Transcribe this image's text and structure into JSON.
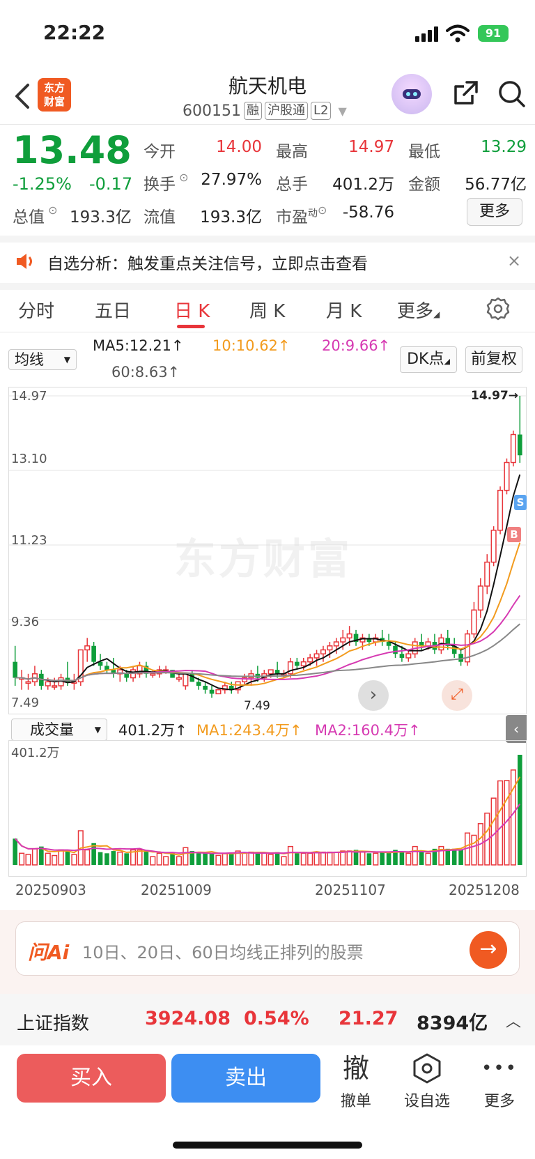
{
  "status": {
    "time": "22:22",
    "battery": "91"
  },
  "header": {
    "logo_text": "东方财富",
    "stock_name": "航天机电",
    "code": "600151",
    "tags": [
      "融",
      "沪股通",
      "L2"
    ]
  },
  "quote": {
    "price": "13.48",
    "change_pct": "-1.25%",
    "change_abs": "-0.17",
    "fields": [
      {
        "label": "今开",
        "value": "14.00",
        "color": "red"
      },
      {
        "label": "最高",
        "value": "14.97",
        "color": "red"
      },
      {
        "label": "最低",
        "value": "13.29",
        "color": "green"
      },
      {
        "label": "换手",
        "value": "27.97%",
        "color": "black"
      },
      {
        "label": "总手",
        "value": "401.2万",
        "color": "black"
      },
      {
        "label": "金额",
        "value": "56.77亿",
        "color": "black"
      },
      {
        "label": "流值",
        "value": "193.3亿",
        "color": "black"
      },
      {
        "label": "市盈",
        "value": "-58.76",
        "color": "black"
      }
    ],
    "total_value_label": "总值",
    "total_value": "193.3亿",
    "pe_super": "动",
    "more_label": "更多"
  },
  "notice": {
    "text": "自选分析：触发重点关注信号，立即点击查看",
    "close": "×"
  },
  "tabs": [
    "分时",
    "五日",
    "日 K",
    "周 K",
    "月 K",
    "更多"
  ],
  "ma_row": {
    "select": "均线",
    "ma5": "MA5:12.21↑",
    "ma10": "10:10.62↑",
    "ma20": "20:9.66↑",
    "ma60": "60:8.63↑",
    "dk": "DK点",
    "fq": "前复权"
  },
  "chart": {
    "price_ticks": [
      "14.97",
      "13.10",
      "11.23",
      "9.36",
      "7.49"
    ],
    "high_label": "14.97→",
    "low_label": "7.49",
    "watermark": "东方财富",
    "s_mark": "S",
    "b_mark": "B"
  },
  "chart_data": {
    "type": "candlestick",
    "ylim": [
      7.49,
      14.97
    ],
    "candles": [
      [
        8.3,
        8.7,
        7.7,
        7.9
      ],
      [
        7.9,
        8.1,
        7.6,
        7.9
      ],
      [
        7.8,
        8.0,
        7.6,
        7.8
      ],
      [
        7.8,
        8.2,
        7.7,
        8.0
      ],
      [
        8.0,
        8.1,
        7.6,
        7.7
      ],
      [
        7.7,
        7.9,
        7.6,
        7.8
      ],
      [
        7.7,
        7.9,
        7.6,
        7.7
      ],
      [
        7.7,
        8.0,
        7.6,
        7.9
      ],
      [
        7.9,
        8.3,
        7.7,
        7.8
      ],
      [
        7.8,
        8.0,
        7.6,
        7.8
      ],
      [
        7.8,
        8.6,
        7.7,
        8.6
      ],
      [
        8.6,
        8.9,
        8.3,
        8.7
      ],
      [
        8.7,
        8.8,
        8.2,
        8.3
      ],
      [
        8.3,
        8.5,
        8.1,
        8.2
      ],
      [
        8.2,
        8.3,
        8.0,
        8.1
      ],
      [
        8.1,
        8.4,
        7.9,
        8.0
      ],
      [
        8.0,
        8.2,
        7.8,
        8.1
      ],
      [
        8.0,
        8.1,
        7.8,
        7.9
      ],
      [
        7.9,
        8.2,
        7.8,
        8.1
      ],
      [
        8.0,
        8.3,
        7.9,
        8.2
      ],
      [
        8.2,
        8.3,
        7.9,
        8.0
      ],
      [
        8.0,
        8.1,
        7.9,
        8.0
      ],
      [
        8.0,
        8.2,
        7.9,
        8.1
      ],
      [
        8.1,
        8.2,
        8.0,
        8.1
      ],
      [
        8.1,
        8.1,
        7.9,
        7.9
      ],
      [
        7.9,
        8.0,
        7.8,
        7.9
      ],
      [
        7.7,
        8.0,
        7.6,
        8.0
      ],
      [
        8.0,
        8.1,
        7.8,
        7.8
      ],
      [
        7.8,
        7.9,
        7.6,
        7.7
      ],
      [
        7.7,
        7.8,
        7.5,
        7.6
      ],
      [
        7.6,
        7.7,
        7.4,
        7.5
      ],
      [
        7.5,
        7.6,
        7.49,
        7.6
      ],
      [
        7.6,
        7.8,
        7.5,
        7.7
      ],
      [
        7.7,
        7.8,
        7.5,
        7.6
      ],
      [
        7.6,
        7.8,
        7.5,
        7.8
      ],
      [
        7.8,
        8.0,
        7.7,
        7.9
      ],
      [
        7.9,
        8.1,
        7.7,
        8.0
      ],
      [
        8.0,
        8.2,
        7.8,
        7.9
      ],
      [
        7.9,
        8.1,
        7.8,
        8.0
      ],
      [
        8.0,
        8.1,
        7.9,
        8.1
      ],
      [
        8.1,
        8.3,
        7.9,
        8.0
      ],
      [
        8.0,
        8.1,
        7.9,
        8.0
      ],
      [
        8.0,
        8.4,
        7.9,
        8.3
      ],
      [
        8.3,
        8.4,
        8.1,
        8.2
      ],
      [
        8.2,
        8.4,
        8.1,
        8.3
      ],
      [
        8.3,
        8.5,
        8.2,
        8.4
      ],
      [
        8.4,
        8.6,
        8.2,
        8.5
      ],
      [
        8.5,
        8.7,
        8.3,
        8.6
      ],
      [
        8.6,
        8.8,
        8.4,
        8.7
      ],
      [
        8.7,
        8.9,
        8.5,
        8.8
      ],
      [
        8.8,
        9.1,
        8.6,
        8.9
      ],
      [
        8.9,
        9.2,
        8.7,
        9.0
      ],
      [
        9.0,
        9.1,
        8.7,
        8.8
      ],
      [
        8.8,
        9.0,
        8.6,
        8.9
      ],
      [
        8.9,
        9.0,
        8.7,
        8.8
      ],
      [
        8.8,
        9.0,
        8.7,
        8.9
      ],
      [
        8.9,
        9.1,
        8.7,
        8.8
      ],
      [
        8.8,
        9.0,
        8.6,
        8.7
      ],
      [
        8.7,
        8.8,
        8.4,
        8.5
      ],
      [
        8.5,
        8.7,
        8.3,
        8.4
      ],
      [
        8.4,
        8.6,
        8.3,
        8.5
      ],
      [
        8.5,
        8.9,
        8.4,
        8.8
      ],
      [
        8.8,
        9.0,
        8.6,
        8.7
      ],
      [
        8.7,
        8.9,
        8.6,
        8.8
      ],
      [
        8.8,
        9.0,
        8.5,
        8.6
      ],
      [
        8.6,
        9.0,
        8.5,
        8.9
      ],
      [
        8.9,
        9.1,
        8.6,
        8.7
      ],
      [
        8.7,
        8.9,
        8.4,
        8.5
      ],
      [
        8.5,
        8.6,
        8.2,
        8.3
      ],
      [
        8.3,
        9.1,
        8.2,
        9.0
      ],
      [
        9.0,
        9.8,
        8.9,
        9.6
      ],
      [
        9.6,
        10.4,
        9.4,
        10.2
      ],
      [
        10.2,
        11.0,
        10.0,
        10.8
      ],
      [
        10.8,
        11.7,
        10.7,
        11.6
      ],
      [
        11.6,
        12.7,
        11.5,
        12.6
      ],
      [
        12.6,
        13.4,
        12.5,
        13.3
      ],
      [
        13.3,
        14.1,
        13.2,
        14.0
      ],
      [
        14.0,
        14.97,
        13.29,
        13.48
      ]
    ]
  },
  "volume": {
    "select": "成交量",
    "current": "401.2万↑",
    "ma1": "MA1:243.4万↑",
    "ma2": "MA2:160.4万↑",
    "max_label": "401.2万",
    "collapse": "‹",
    "dates": [
      "20250903",
      "20251009",
      "20251107",
      "20251208"
    ]
  },
  "ai": {
    "logo": "问Ai",
    "text": "10日、20日、60日均线正排列的股票"
  },
  "index": {
    "name": "上证指数",
    "value": "3924.08",
    "pct": "0.54%",
    "chg": "21.27",
    "amount": "8394亿"
  },
  "bottom": {
    "buy": "买入",
    "sell": "卖出",
    "tools": [
      {
        "glyph": "撤",
        "label": "撤单"
      },
      {
        "glyph": "⬡",
        "label": "设自选"
      },
      {
        "glyph": "•••",
        "label": "更多"
      }
    ]
  },
  "colors": {
    "up": "#e8353a",
    "down": "#0f9e3b",
    "ma10": "#f29b1e",
    "ma20": "#d63ab2",
    "accent": "#f05a22"
  }
}
